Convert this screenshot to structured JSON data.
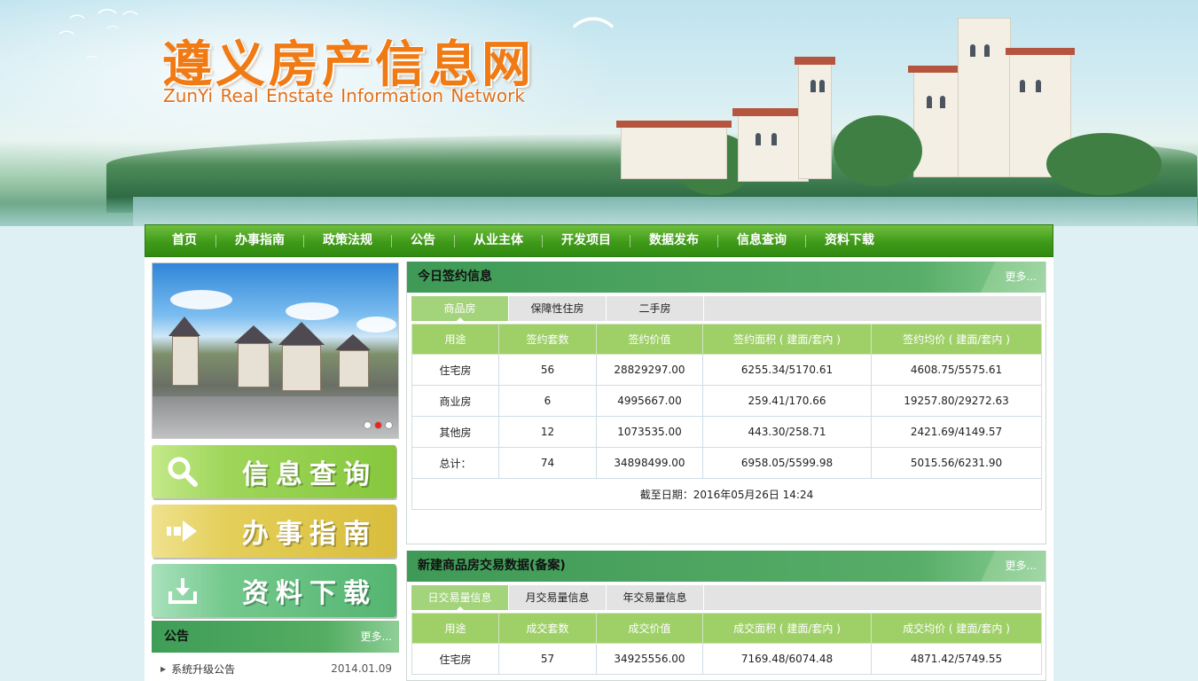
{
  "header": {
    "logo_cn": "遵义房产信息网",
    "logo_en": "ZunYi Real Enstate Information Network"
  },
  "nav": {
    "items": [
      "首页",
      "办事指南",
      "政策法规",
      "公告",
      "从业主体",
      "开发项目",
      "数据发布",
      "信息查询",
      "资料下载"
    ]
  },
  "sidebar": {
    "quick_links": [
      {
        "label": "信息查询",
        "icon": "search-icon"
      },
      {
        "label": "办事指南",
        "icon": "arrow-right-icon"
      },
      {
        "label": "资料下载",
        "icon": "download-icon"
      }
    ],
    "notice": {
      "title": "公告",
      "more": "更多...",
      "items": [
        {
          "title": "系统升级公告",
          "date": "2014.01.09"
        }
      ]
    },
    "slider": {
      "active_dot": 2,
      "dots": 3
    }
  },
  "today_sign": {
    "title": "今日签约信息",
    "more": "更多...",
    "tabs": [
      "商品房",
      "保障性住房",
      "二手房"
    ],
    "active_tab": 0,
    "columns": [
      "用途",
      "签约套数",
      "签约价值",
      "签约面积 ( 建面/套内 )",
      "签约均价 ( 建面/套内 )"
    ],
    "rows": [
      [
        "住宅房",
        "56",
        "28829297.00",
        "6255.34/5170.61",
        "4608.75/5575.61"
      ],
      [
        "商业房",
        "6",
        "4995667.00",
        "259.41/170.66",
        "19257.80/29272.63"
      ],
      [
        "其他房",
        "12",
        "1073535.00",
        "443.30/258.71",
        "2421.69/4149.57"
      ],
      [
        "总计：",
        "74",
        "34898499.00",
        "6958.05/5599.98",
        "5015.56/6231.90"
      ]
    ],
    "cutoff": "截至日期：2016年05月26日 14:24"
  },
  "new_trade": {
    "title": "新建商品房交易数据(备案)",
    "more": "更多...",
    "tabs": [
      "日交易量信息",
      "月交易量信息",
      "年交易量信息"
    ],
    "active_tab": 0,
    "columns": [
      "用途",
      "成交套数",
      "成交价值",
      "成交面积 ( 建面/套内 )",
      "成交均价 ( 建面/套内 )"
    ],
    "rows": [
      [
        "住宅房",
        "57",
        "34925556.00",
        "7169.48/6074.48",
        "4871.42/5749.55"
      ]
    ]
  },
  "colors": {
    "nav_green": "#3f9a1a",
    "panel_green": "#58ad68",
    "table_head": "#9fd068",
    "logo_orange": "#f07a14"
  }
}
